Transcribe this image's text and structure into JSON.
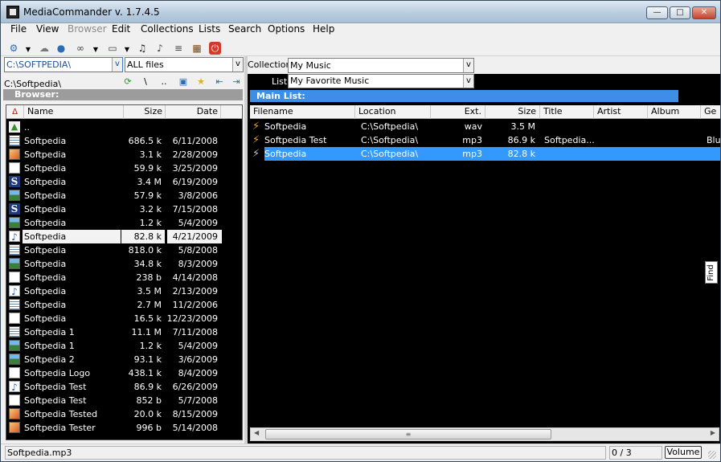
{
  "window": {
    "title": "MediaCommander v. 1.7.4.5",
    "caption_buttons": [
      "minimize",
      "maximize",
      "close"
    ]
  },
  "menu": [
    {
      "label": "File",
      "enabled": true
    },
    {
      "label": "View",
      "enabled": true
    },
    {
      "label": "Browser",
      "enabled": false
    },
    {
      "label": "Edit",
      "enabled": true
    },
    {
      "label": "Collections",
      "enabled": true
    },
    {
      "label": "Lists",
      "enabled": true
    },
    {
      "label": "Search",
      "enabled": true
    },
    {
      "label": "Options",
      "enabled": true
    },
    {
      "label": "Help",
      "enabled": true
    }
  ],
  "toolbar_icons": [
    "settings-icon",
    "cloud-icon",
    "info-db-icon",
    "binoculars-icon",
    "window-icon",
    "id3-icon",
    "convert-icon",
    "rename-icon",
    "calendar-icon",
    "exit-icon"
  ],
  "browser": {
    "drive": "C:\\SOFTPEDIA\\",
    "drive_arrow": "v",
    "filter": "ALL files",
    "filter_arrow": "v",
    "current_path": "C:\\Softpedia\\",
    "nav_up_label": "..",
    "nav_back_label": "\\",
    "title": "Browser:",
    "columns": {
      "name": "Name",
      "size": "Size",
      "date": "Date"
    },
    "parent_label": "..",
    "selected_index": 7,
    "rows": [
      {
        "icon": "sheet",
        "name": "Softpedia",
        "size": "686.5 k",
        "date": "6/11/2008"
      },
      {
        "icon": "orange",
        "name": "Softpedia",
        "size": "3.1 k",
        "date": "2/28/2009"
      },
      {
        "icon": "doc",
        "name": "Softpedia",
        "size": "59.9 k",
        "date": "3/25/2009"
      },
      {
        "icon": "s",
        "name": "Softpedia",
        "size": "3.4 M",
        "date": "6/19/2009"
      },
      {
        "icon": "img",
        "name": "Softpedia",
        "size": "57.9 k",
        "date": "3/8/2006"
      },
      {
        "icon": "s",
        "name": "Softpedia",
        "size": "3.2 k",
        "date": "7/15/2008"
      },
      {
        "icon": "img",
        "name": "Softpedia",
        "size": "1.2 k",
        "date": "5/4/2009"
      },
      {
        "icon": "music",
        "name": "Softpedia",
        "size": "82.8 k",
        "date": "4/21/2009"
      },
      {
        "icon": "sheet",
        "name": "Softpedia",
        "size": "818.0 k",
        "date": "5/8/2008"
      },
      {
        "icon": "img",
        "name": "Softpedia",
        "size": "34.8 k",
        "date": "8/3/2009"
      },
      {
        "icon": "doc",
        "name": "Softpedia",
        "size": "238 b",
        "date": "4/14/2008"
      },
      {
        "icon": "music",
        "name": "Softpedia",
        "size": "3.5 M",
        "date": "2/13/2009"
      },
      {
        "icon": "sheet",
        "name": "Softpedia",
        "size": "2.7 M",
        "date": "11/2/2006"
      },
      {
        "icon": "doc",
        "name": "Softpedia",
        "size": "16.5 k",
        "date": "12/23/2009"
      },
      {
        "icon": "sheet",
        "name": "Softpedia 1",
        "size": "11.1 M",
        "date": "7/11/2008"
      },
      {
        "icon": "img",
        "name": "Softpedia 1",
        "size": "1.2 k",
        "date": "5/4/2009"
      },
      {
        "icon": "img",
        "name": "Softpedia 2",
        "size": "93.1 k",
        "date": "3/6/2009"
      },
      {
        "icon": "doc",
        "name": "Softpedia Logo",
        "size": "438.1 k",
        "date": "8/4/2009"
      },
      {
        "icon": "music",
        "name": "Softpedia Test",
        "size": "86.9 k",
        "date": "6/26/2009"
      },
      {
        "icon": "doc",
        "name": "Softpedia Test",
        "size": "852 b",
        "date": "5/7/2008"
      },
      {
        "icon": "orange",
        "name": "Softpedia Tested",
        "size": "20.0 k",
        "date": "8/15/2009"
      },
      {
        "icon": "orange",
        "name": "Softpedia Tester",
        "size": "996 b",
        "date": "5/14/2008"
      }
    ]
  },
  "collection": {
    "label": "Collection:",
    "value": "My Music",
    "arrow": "v"
  },
  "list": {
    "label": "List:",
    "value": "My Favorite Music",
    "arrow": "v"
  },
  "main_list": {
    "title": "Main List:",
    "columns": [
      "Filename",
      "Location",
      "Ext.",
      "Size",
      "Title",
      "Artist",
      "Album",
      "Ge"
    ],
    "selected_index": 2,
    "rows": [
      {
        "filename": "Softpedia",
        "location": "C:\\Softpedia\\",
        "ext": "wav",
        "size": "3.5 M",
        "title": "",
        "genre": ""
      },
      {
        "filename": "Softpedia Test",
        "location": "C:\\Softpedia\\",
        "ext": "mp3",
        "size": "86.9 k",
        "title": "Softpedia...",
        "genre": "Blu"
      },
      {
        "filename": "Softpedia",
        "location": "C:\\Softpedia\\",
        "ext": "mp3",
        "size": "82.8 k",
        "title": "",
        "genre": ""
      }
    ]
  },
  "find_tab": "Find",
  "status": {
    "file": "Softpedia.mp3",
    "count": "0 / 3",
    "volume_label": "Volume"
  },
  "colors": {
    "selection": "#3399ff",
    "panel_bg": "#000000",
    "header_bar": "#3d8ee6",
    "browser_bar": "#9c9c9c"
  }
}
